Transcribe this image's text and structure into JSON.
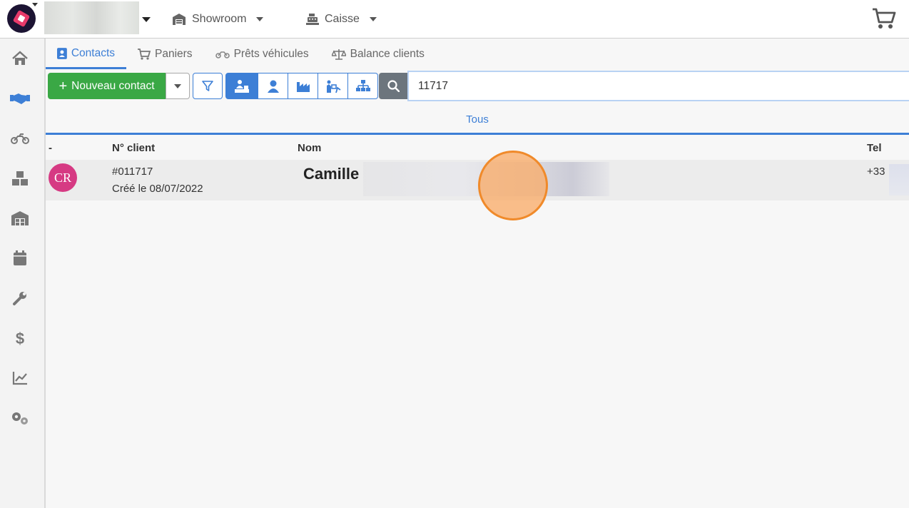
{
  "topbar": {
    "showroom_label": "Showroom",
    "caisse_label": "Caisse"
  },
  "tabs": [
    {
      "label": "Contacts",
      "icon": "contact-card-icon",
      "active": true
    },
    {
      "label": "Paniers",
      "icon": "cart-icon",
      "active": false
    },
    {
      "label": "Prêts véhicules",
      "icon": "motorcycle-icon",
      "active": false
    },
    {
      "label": "Balance clients",
      "icon": "balance-scale-icon",
      "active": false
    }
  ],
  "sidebar": {
    "items": [
      {
        "icon": "home-icon"
      },
      {
        "icon": "handshake-icon",
        "active": true
      },
      {
        "icon": "motorcycle-icon"
      },
      {
        "icon": "boxes-icon"
      },
      {
        "icon": "warehouse-icon"
      },
      {
        "icon": "calendar-icon"
      },
      {
        "icon": "wrench-icon"
      },
      {
        "icon": "dollar-icon"
      },
      {
        "icon": "chart-line-icon"
      },
      {
        "icon": "gears-icon"
      }
    ]
  },
  "toolbar": {
    "new_contact_label": "Nouveau contact",
    "search_value": "11717"
  },
  "filter": {
    "all_label": "Tous"
  },
  "table": {
    "headers": {
      "dash": "-",
      "client_no": "N° client",
      "name": "Nom",
      "tel": "Tel"
    },
    "rows": [
      {
        "initials": "CR",
        "client_no": "#011717",
        "created": "Créé le 08/07/2022",
        "name": "Camille",
        "tel": "+33"
      }
    ]
  },
  "colors": {
    "accent": "#3d7fd6",
    "success": "#3aa845",
    "avatar": "#d63a83",
    "click_indicator": "#f08a2a"
  }
}
